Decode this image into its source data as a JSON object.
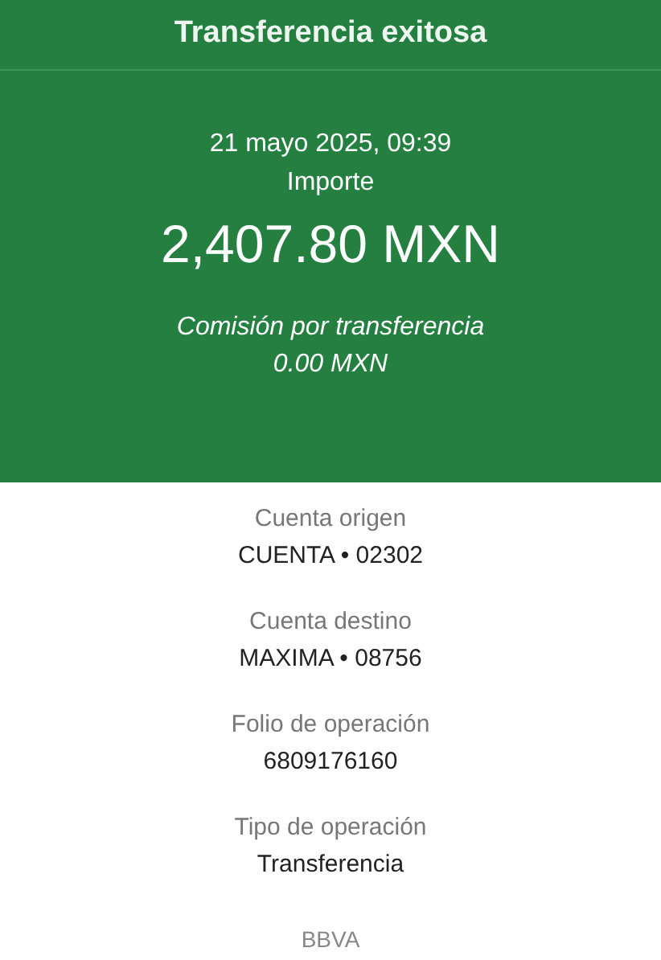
{
  "header": {
    "title": "Transferencia exitosa"
  },
  "summary": {
    "datetime": "21 mayo 2025, 09:39",
    "amount_label": "Importe",
    "amount": "2,407.80 MXN",
    "fee_label": "Comisión por transferencia",
    "fee": "0.00 MXN"
  },
  "details": [
    {
      "label": "Cuenta origen",
      "value": "CUENTA • 02302"
    },
    {
      "label": "Cuenta destino",
      "value": "MAXIMA • 08756"
    },
    {
      "label": "Folio de operación",
      "value": "6809176160"
    },
    {
      "label": "Tipo de operación",
      "value": "Transferencia"
    }
  ],
  "footer": {
    "bank": "BBVA"
  }
}
